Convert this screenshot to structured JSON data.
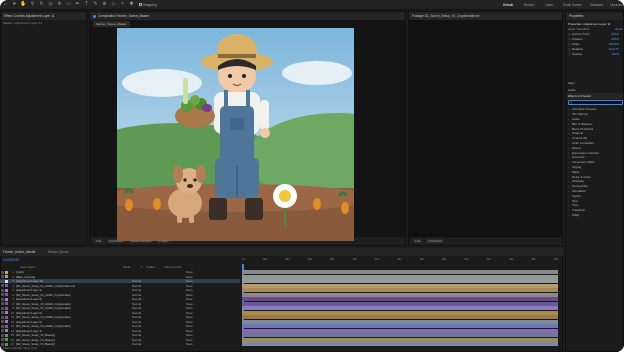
{
  "workspaces": [
    {
      "label": "Default",
      "active": true
    },
    {
      "label": "Review",
      "active": false
    },
    {
      "label": "Learn",
      "active": false
    },
    {
      "label": "Small Screen",
      "active": false
    },
    {
      "label": "Standard",
      "active": false
    },
    {
      "label": "Libraries",
      "active": false
    }
  ],
  "toolbar": {
    "snapping_label": "Snapping"
  },
  "project_panel": {
    "tab": "Effect Controls Adjustment Layer 11",
    "subtitle": "Master • Adjustment Layer 11"
  },
  "comp_panel": {
    "tab": "Composition Farmer_Scene_Master",
    "subtab": "Farmer_Scene_Master"
  },
  "footage_panel": {
    "tab": "Footage 3D_Scene_Setup_V3_Cryptomatte.exr"
  },
  "viewer_footer": {
    "zoom": "Full",
    "timecode": "0;00;00;00",
    "channel": "Active Camera",
    "views": "1 View"
  },
  "properties": {
    "tab": "Properties",
    "title": "Properties: Adjustment Layer 11",
    "section": "Layer Transform",
    "reset_label": "Reset",
    "rows": [
      {
        "name": "Anchor Point",
        "value": "960.0"
      },
      {
        "name": "Position",
        "value": "960.0"
      },
      {
        "name": "Scale",
        "value": "100.0%"
      },
      {
        "name": "Rotation",
        "value": "0x+0.0°"
      },
      {
        "name": "Opacity",
        "value": "100%"
      }
    ]
  },
  "aligns": {
    "align_label": "Align",
    "audio_label": "Audio"
  },
  "effects": {
    "tab": "Effects & Presets",
    "search_placeholder": "",
    "categories": [
      "Animation Presets",
      "3D Channel",
      "Audio",
      "Blur & Sharpen",
      "Boris FX Mocha",
      "Channel",
      "Cinema 4D",
      "Color Correction",
      "Distort",
      "Expression Controls",
      "Generate",
      "Immersive Video",
      "Keying",
      "Matte",
      "Noise & Grain",
      "Obsolete",
      "Perspective",
      "Simulation",
      "Stylize",
      "Text",
      "Time",
      "Transition",
      "Utility"
    ]
  },
  "timeline": {
    "tab": "Farmer_Scene_Master",
    "tab2": "Render Queue",
    "timecode": "0;00;00;00",
    "columns": [
      "Layer Name",
      "Mode",
      "T",
      "TrkMat",
      "Parent & Link"
    ],
    "layers": [
      {
        "num": "1",
        "name": "[Light]",
        "mode": "",
        "parent": "None",
        "color": "#c8a85a",
        "bar": "#8a8a8a"
      },
      {
        "num": "2",
        "name": "[Main_Camera]",
        "mode": "",
        "parent": "None",
        "color": "#a0a0a0",
        "bar": "#8a9a9a"
      },
      {
        "num": "3",
        "name": "[Adjustment Layer 11]",
        "mode": "Normal",
        "parent": "None",
        "color": "#e0e0e0",
        "bar": "#9a9a9a"
      },
      {
        "num": "4",
        "name": "[3D_Scene_Setup_V3_ACES_Cryptomatte.exr]",
        "mode": "Normal",
        "parent": "None",
        "color": "#7a5aa0",
        "bar": "#b59a6a"
      },
      {
        "num": "5",
        "name": "[Adjustment Layer 9]",
        "mode": "Normal",
        "parent": "None",
        "color": "#a080c0",
        "bar": "#a88a5a"
      },
      {
        "num": "6",
        "name": "[3D_Scene_Setup_V3_ACES_Cryptomatte]",
        "mode": "Normal",
        "parent": "None",
        "color": "#7a5aa0",
        "bar": "#8a8a8a"
      },
      {
        "num": "7",
        "name": "[Adjustment Layer 8]",
        "mode": "Normal",
        "parent": "None",
        "color": "#a080c0",
        "bar": "#6a4a8a"
      },
      {
        "num": "8",
        "name": "[3D_Scene_Setup_V3_ACES_Cryptomatte]",
        "mode": "Normal",
        "parent": "None",
        "color": "#7a5aa0",
        "bar": "#6a5a9a"
      },
      {
        "num": "9",
        "name": "[3D_Scene_Setup_V3_ACES_Cryptomatte]",
        "mode": "Normal",
        "parent": "None",
        "color": "#7a5aa0",
        "bar": "#8a7ac0"
      },
      {
        "num": "10",
        "name": "[Adjustment Layer 6]",
        "mode": "Normal",
        "parent": "None",
        "color": "#a080c0",
        "bar": "#a88a4a"
      },
      {
        "num": "11",
        "name": "[3D_Scene_Setup_V3_ACES_Cryptomatte]",
        "mode": "Normal",
        "parent": "None",
        "color": "#7a5aa0",
        "bar": "#9a7a4a"
      },
      {
        "num": "12",
        "name": "[Adjustment Layer 5]",
        "mode": "Normal",
        "parent": "None",
        "color": "#a080c0",
        "bar": "#7a8aa0"
      },
      {
        "num": "13",
        "name": "[3D_Scene_Setup_V3_ACES_Cryptomatte]",
        "mode": "Normal",
        "parent": "None",
        "color": "#7a5aa0",
        "bar": "#6a7ab0"
      },
      {
        "num": "14",
        "name": "[Adjustment Layer 4]",
        "mode": "Normal",
        "parent": "None",
        "color": "#a080c0",
        "bar": "#8a6ab0"
      },
      {
        "num": "15",
        "name": "[3D_Scene_Setup_V3_Beauty]",
        "mode": "Normal",
        "parent": "None",
        "color": "#5a9a5a",
        "bar": "#6a7a9a"
      },
      {
        "num": "16",
        "name": "[3D_Scene_Setup_V3_Beauty]",
        "mode": "Normal",
        "parent": "None",
        "color": "#5a9a5a",
        "bar": "#a08a5a"
      },
      {
        "num": "17",
        "name": "[3D_Scene_Setup_V3_Beauty]",
        "mode": "Normal",
        "parent": "None",
        "color": "#5a9a5a",
        "bar": "#7a8aa8"
      }
    ],
    "footer_label": "Frame Render Time: 0ms",
    "ruler": [
      "0s",
      "02s",
      "04s",
      "06s",
      "08s",
      "10s",
      "12s",
      "14s",
      "16s",
      "18s",
      "20s",
      "22s",
      "24s",
      "26s",
      "28s"
    ]
  },
  "colors": {
    "accent": "#3a86ff",
    "bg": "#1d1d1d",
    "panel": "#1b1b1b"
  }
}
